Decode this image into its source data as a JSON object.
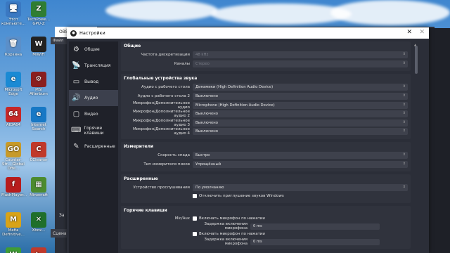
{
  "desktop": {
    "icons": [
      {
        "label": "Этот компьюте...",
        "symbol": "🖥",
        "color": "#3a78c2"
      },
      {
        "label": "TechPowe... GPU-Z",
        "symbol": "Z",
        "color": "#2f7d32"
      },
      {
        "label": "Корзина",
        "symbol": "🗑",
        "color": "#5b8fc9"
      },
      {
        "label": "MiWiFi",
        "symbol": "W",
        "color": "#222"
      },
      {
        "label": "Microsoft Edge",
        "symbol": "e",
        "color": "#1a8ad4"
      },
      {
        "label": "MSI Afterburn",
        "symbol": "⚙",
        "color": "#8a1f1f"
      },
      {
        "label": "AIDA64",
        "symbol": "64",
        "color": "#c62828"
      },
      {
        "label": "Internet Search",
        "symbol": "e",
        "color": "#1778c5"
      },
      {
        "label": "Counter-Str... Global Offe...",
        "symbol": "GO",
        "color": "#c79a2a"
      },
      {
        "label": "CCleaner",
        "symbol": "C",
        "color": "#c0392b"
      },
      {
        "label": "FlashPlayer...",
        "symbol": "f",
        "color": "#b71c1c"
      },
      {
        "label": "Minecraft",
        "symbol": "▦",
        "color": "#4c8b2f"
      },
      {
        "label": "Mafia Definitive...",
        "symbol": "M",
        "color": "#d8a318"
      },
      {
        "label": "Xbox...",
        "symbol": "✕",
        "color": "#1f6f2a"
      },
      {
        "label": "",
        "symbol": "W",
        "color": "#3f9c35"
      },
      {
        "label": "",
        "symbol": "▶",
        "color": "#c0392b"
      }
    ]
  },
  "obs_back": {
    "title": "OBS",
    "file_menu": "Файл",
    "scene_label": "Сцена",
    "z_label": "За"
  },
  "dialog": {
    "title": "Настройки",
    "close": "✕",
    "sidebar": [
      {
        "label": "Общие",
        "icon": "gear-icon",
        "glyph": "⚙",
        "active": false
      },
      {
        "label": "Трансляция",
        "icon": "broadcast-icon",
        "glyph": "📡",
        "active": false
      },
      {
        "label": "Вывод",
        "icon": "output-icon",
        "glyph": "▭",
        "active": false
      },
      {
        "label": "Аудио",
        "icon": "speaker-icon",
        "glyph": "🔊",
        "active": true
      },
      {
        "label": "Видео",
        "icon": "monitor-icon",
        "glyph": "▢",
        "active": false
      },
      {
        "label": "Горячие клавиши",
        "icon": "keyboard-icon",
        "glyph": "⌨",
        "active": false
      },
      {
        "label": "Расширенные",
        "icon": "wrench-icon",
        "glyph": "✎",
        "active": false
      }
    ],
    "general": {
      "title": "Общие",
      "rows": [
        {
          "label": "Частота дискретизации",
          "value": "48 kHz",
          "dim": true
        },
        {
          "label": "Каналы",
          "value": "Стерео",
          "dim": true
        }
      ]
    },
    "devices": {
      "title": "Глобальные устройства звука",
      "rows": [
        {
          "label": "Аудио с рабочего стола",
          "value": "Динамики (High Definition Audio Device)"
        },
        {
          "label": "Аудио с рабочего стола 2",
          "value": "Выключено"
        },
        {
          "label": "Микрофон/Дополнительное аудио",
          "value": "Microphone (High Definition Audio Device)"
        },
        {
          "label": "Микрофон/Дополнительное аудио 2",
          "value": "Выключено"
        },
        {
          "label": "Микрофон/Дополнительное аудио 3",
          "value": "Выключено"
        },
        {
          "label": "Микрофон/Дополнительное аудио 4",
          "value": "Выключено"
        }
      ]
    },
    "meters": {
      "title": "Измерители",
      "rows": [
        {
          "label": "Скорость спада",
          "value": "Быстро"
        },
        {
          "label": "Тип измерителя пиков",
          "value": "Упрощённый"
        }
      ]
    },
    "advanced": {
      "title": "Расширенные",
      "rows": [
        {
          "label": "Устройство прослушивания",
          "value": "По умолчанию"
        }
      ],
      "checkbox": "Отключить приглушение звуков Windows"
    },
    "hotkeys": {
      "title": "Горячие клавиши",
      "device": "Mic/Aux",
      "items": [
        {
          "type": "check",
          "label": "Включать микрофон по нажатии"
        },
        {
          "type": "field",
          "label": "Задержка включения микрофона",
          "value": "0 ms"
        },
        {
          "type": "check",
          "label": "Включать микрофон по нажатии"
        },
        {
          "type": "field",
          "label": "Задержка включения микрофона",
          "value": "0 ms"
        }
      ]
    }
  }
}
